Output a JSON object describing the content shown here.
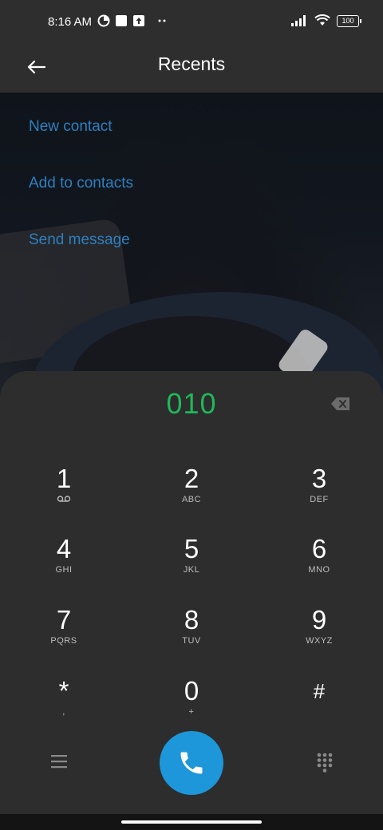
{
  "status_bar": {
    "time": "8:16 AM",
    "battery": "100",
    "icons": [
      "data-saver-icon",
      "square-notification-icon",
      "upload-icon",
      "more-dots-icon",
      "signal-icon",
      "wifi-icon",
      "battery-icon"
    ]
  },
  "app_bar": {
    "title": "Recents"
  },
  "actions": {
    "new_contact": "New contact",
    "add_to_contacts": "Add to contacts",
    "send_message": "Send message"
  },
  "dialer": {
    "entered_number": "010",
    "keys": [
      {
        "digit": "1",
        "letters": "voicemail-icon"
      },
      {
        "digit": "2",
        "letters": "ABC"
      },
      {
        "digit": "3",
        "letters": "DEF"
      },
      {
        "digit": "4",
        "letters": "GHI"
      },
      {
        "digit": "5",
        "letters": "JKL"
      },
      {
        "digit": "6",
        "letters": "MNO"
      },
      {
        "digit": "7",
        "letters": "PQRS"
      },
      {
        "digit": "8",
        "letters": "TUV"
      },
      {
        "digit": "9",
        "letters": "WXYZ"
      },
      {
        "digit": "*",
        "letters": ","
      },
      {
        "digit": "0",
        "letters": "+"
      },
      {
        "digit": "#",
        "letters": ""
      }
    ]
  },
  "colors": {
    "number": "#1fb85a",
    "call_button": "#1e96da",
    "action_link": "#2e7fbf",
    "sheet": "#2d2d2d"
  }
}
